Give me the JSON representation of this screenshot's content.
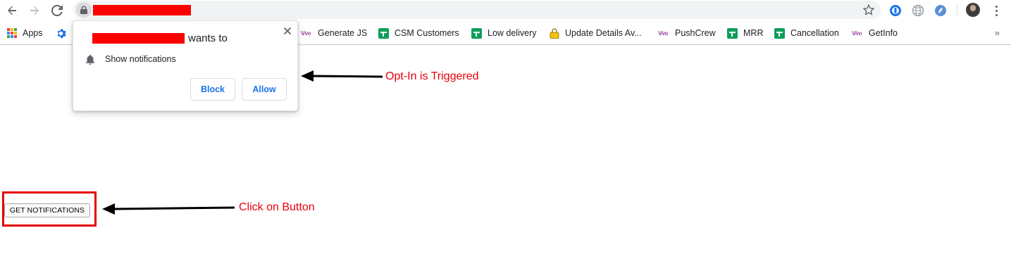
{
  "toolbar": {
    "back_icon": "arrow-left-icon",
    "forward_icon": "arrow-right-icon",
    "reload_icon": "reload-icon",
    "lock_icon": "lock-icon",
    "url_redaction_color": "#ff0000",
    "bookmark_star_icon": "star-icon",
    "extensions": [
      "1password-icon",
      "globe-icon",
      "extension-icon"
    ],
    "menu_icon": "kebab-menu-icon"
  },
  "bookmarks": {
    "items": [
      {
        "label": "Apps",
        "icon": "apps-grid-icon"
      },
      {
        "label": "",
        "icon": "gear-icon"
      },
      {
        "label": "Generate JS",
        "icon": "vwo-icon"
      },
      {
        "label": "CSM Customers",
        "icon": "google-sheets-icon"
      },
      {
        "label": "Low delivery",
        "icon": "google-sheets-icon"
      },
      {
        "label": "Update Details Av...",
        "icon": "lock-icon"
      },
      {
        "label": "PushCrew",
        "icon": "vwo-icon"
      },
      {
        "label": "MRR",
        "icon": "google-sheets-icon"
      },
      {
        "label": "Cancellation",
        "icon": "google-sheets-icon"
      },
      {
        "label": "GetInfo",
        "icon": "vwo-icon"
      }
    ],
    "overflow": "»"
  },
  "popup": {
    "title_suffix": "wants to",
    "permission": "Show notifications",
    "block_label": "Block",
    "allow_label": "Allow",
    "accent": "#1a73e8"
  },
  "page": {
    "button_label": "GET NOTIFICATIONS",
    "annotation_optin": "Opt-In is Triggered",
    "annotation_click": "Click on Button",
    "annotation_color": "#e8000b"
  }
}
